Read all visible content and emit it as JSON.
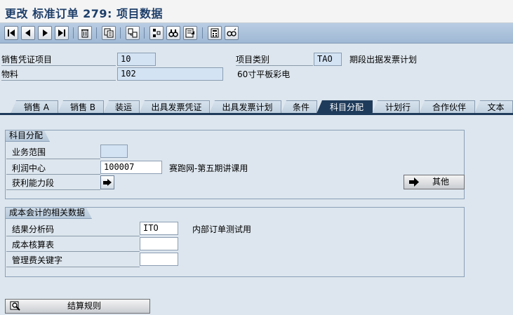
{
  "window": {
    "title": "更改 标准订单 279: 项目数据"
  },
  "toolbar": {
    "buttons": [
      "first-icon",
      "previous-icon",
      "next-icon",
      "last-icon",
      "delete-icon",
      "copy-item-icon",
      "document-flow-icon",
      "config-icon",
      "find-icon",
      "details-icon",
      "calculator-icon",
      "glasses-icon"
    ]
  },
  "header": {
    "item_label": "销售凭证项目",
    "item_value": "10",
    "item_category_label": "项目类别",
    "item_category_value": "TAO",
    "item_category_desc": "期段出据发票计划",
    "material_label": "物料",
    "material_value": "102",
    "material_desc": "60寸平板彩电"
  },
  "tabs": [
    {
      "label": "销售 A",
      "active": false
    },
    {
      "label": "销售 B",
      "active": false
    },
    {
      "label": "装运",
      "active": false
    },
    {
      "label": "出具发票凭证",
      "active": false
    },
    {
      "label": "出具发票计划",
      "active": false
    },
    {
      "label": "条件",
      "active": false
    },
    {
      "label": "科目分配",
      "active": true
    },
    {
      "label": "计划行",
      "active": false
    },
    {
      "label": "合作伙伴",
      "active": false
    },
    {
      "label": "文本",
      "active": false
    }
  ],
  "account_assignment": {
    "group_title": "科目分配",
    "business_area_label": "业务范围",
    "business_area_value": "",
    "profit_center_label": "利润中心",
    "profit_center_value": "100007",
    "profit_center_desc": "赛跑网-第五期讲课用",
    "profitability_segment_label": "获利能力段",
    "other_button_label": "其他"
  },
  "cost_accounting": {
    "group_title": "成本会计的相关数据",
    "result_analysis_label": "结果分析码",
    "result_analysis_value": "ITO",
    "result_analysis_desc": "内部订单测试用",
    "costing_sheet_label": "成本核算表",
    "costing_sheet_value": "",
    "overhead_key_label": "管理费关键字",
    "overhead_key_value": ""
  },
  "settlement_button_label": "结算规则",
  "colors": {
    "accent": "#1f3b5b",
    "title": "#1e3f6a",
    "background": "#dde6ee"
  }
}
